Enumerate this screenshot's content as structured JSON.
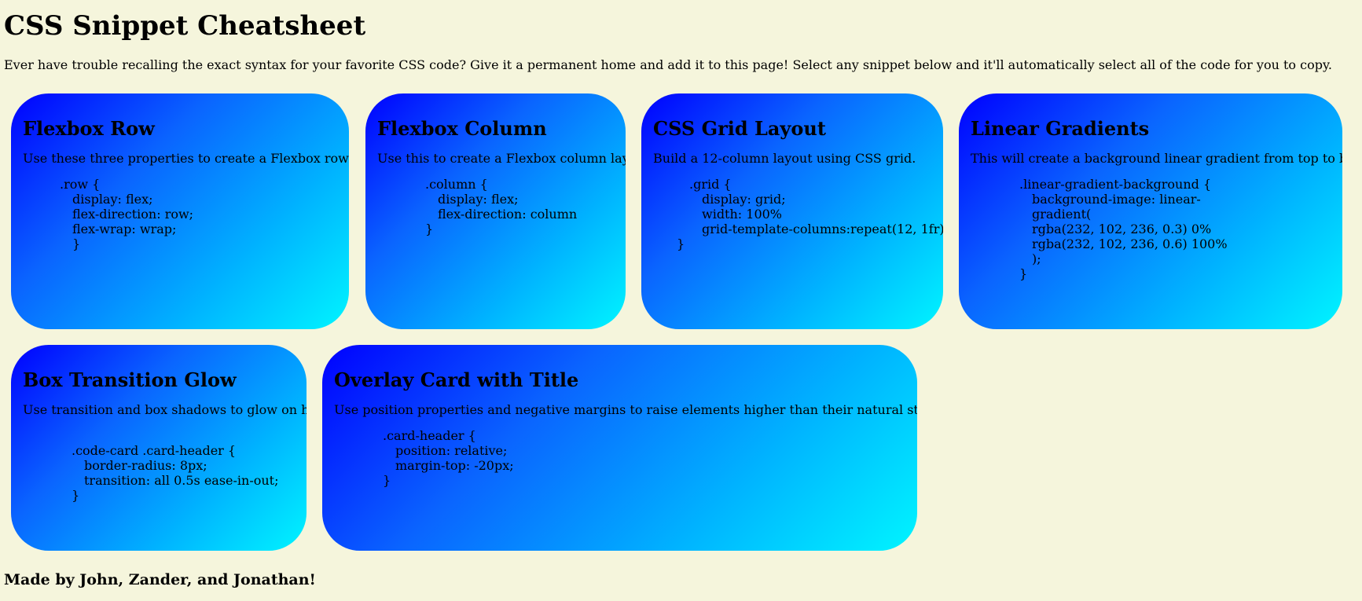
{
  "header": {
    "title": "CSS Snippet Cheatsheet",
    "intro": "Ever have trouble recalling the exact syntax for your favorite CSS code? Give it a permanent home and add it to this page! Select any snippet below and it'll automatically select all of the code for you to copy."
  },
  "cards": [
    {
      "title": "Flexbox Row",
      "description": "Use these three properties to create a Flexbox row layout",
      "code": [
        ".row {",
        "display: flex;",
        "flex-direction: row;",
        "flex-wrap: wrap;",
        "}"
      ]
    },
    {
      "title": "Flexbox Column",
      "description": "Use this to create a Flexbox column layout.",
      "code": [
        ".column {",
        "display: flex;",
        "flex-direction: column",
        "}"
      ]
    },
    {
      "title": "CSS Grid Layout",
      "description": "Build a 12-column layout using CSS grid.",
      "code": [
        ".grid {",
        "display: grid;",
        "width: 100%",
        "grid-template-columns:repeat(12, 1fr);",
        "}"
      ]
    },
    {
      "title": "Linear Gradients",
      "description": "This will create a background linear gradient from top to bottom.",
      "code": [
        ".linear-gradient-background {",
        "background-image: linear-",
        "gradient(",
        "rgba(232, 102, 236, 0.3) 0%",
        "rgba(232, 102, 236, 0.6) 100%",
        ");",
        "}"
      ]
    },
    {
      "title": "Box Transition Glow",
      "description": "Use transition and box shadows to glow on hover",
      "code": [
        ".code-card .card-header {",
        "border-radius: 8px;",
        "transition: all 0.5s ease-in-out;",
        "}"
      ]
    },
    {
      "title": "Overlay Card with Title",
      "description": "Use position properties and negative margins to raise elements higher than their natural starting point.",
      "code": [
        ".card-header {",
        "position: relative;",
        "margin-top: -20px;",
        "}"
      ]
    }
  ],
  "footer": {
    "text": "Made by John, Zander, and Jonathan!"
  },
  "colors": {
    "background": "#f5f5dc",
    "card_gradient_start": "#0000ff",
    "card_gradient_end": "#00f5ff"
  }
}
